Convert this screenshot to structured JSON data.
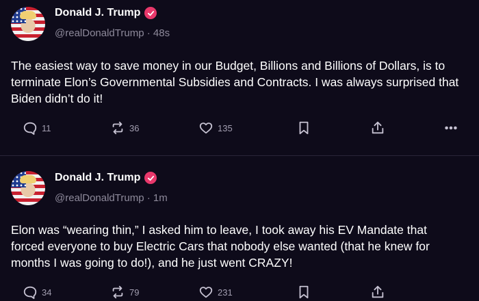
{
  "posts": [
    {
      "author": "Donald J. Trump",
      "handle": "@realDonaldTrump",
      "time": "48s",
      "text": "The easiest way to save money in our Budget, Billions and Billions of Dollars, is to terminate Elon’s Governmental Subsidies and Contracts. I was always surprised that Biden didn’t do it!",
      "replies": "11",
      "reposts": "36",
      "likes": "135"
    },
    {
      "author": "Donald J. Trump",
      "handle": "@realDonaldTrump",
      "time": "1m",
      "text": "Elon was “wearing thin,” I asked him to leave, I took away his EV Mandate that forced everyone to buy Electric Cars that nobody else wanted (that he knew for months I was going to do!), and he just went CRAZY!",
      "replies": "34",
      "reposts": "79",
      "likes": "231"
    }
  ],
  "separator": " · ",
  "colors": {
    "background": "#0e0b1a",
    "verified": "#e8386b",
    "muted": "#8e8a9b"
  },
  "icons": [
    "verified-badge-icon",
    "reply-icon",
    "repost-icon",
    "like-icon",
    "bookmark-icon",
    "share-icon",
    "more-icon"
  ]
}
